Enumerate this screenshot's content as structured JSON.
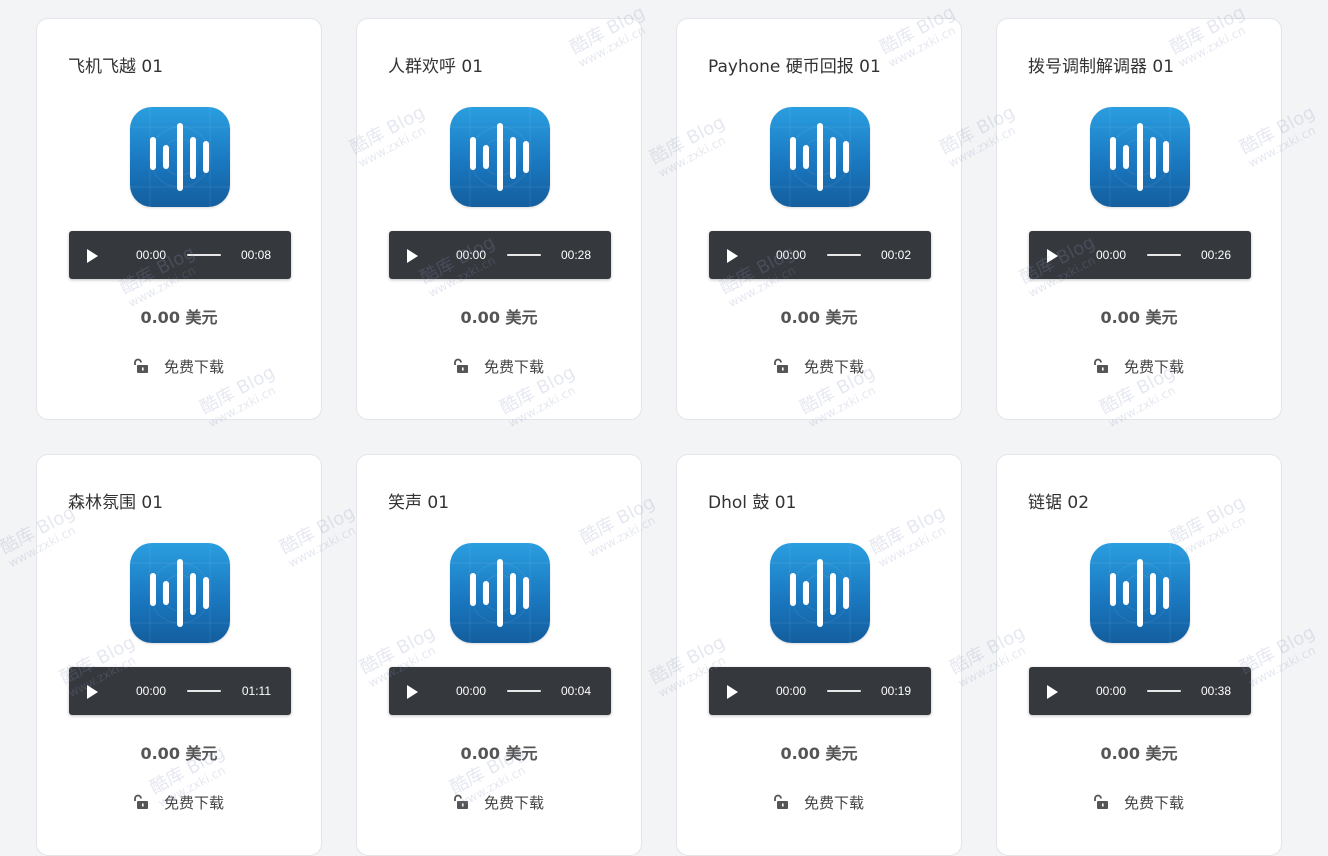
{
  "colors": {
    "icon_top": "#2a9ee0",
    "icon_bottom": "#135e9e",
    "player_bg": "#35383d"
  },
  "cards": [
    {
      "title": "飞机飞越 01",
      "current_time": "00:00",
      "duration": "00:08",
      "price": "0.00 美元",
      "download_label": "免费下载"
    },
    {
      "title": "人群欢呼 01",
      "current_time": "00:00",
      "duration": "00:28",
      "price": "0.00 美元",
      "download_label": "免费下载"
    },
    {
      "title": "Payhone 硬币回报 01",
      "current_time": "00:00",
      "duration": "00:02",
      "price": "0.00 美元",
      "download_label": "免费下载"
    },
    {
      "title": "拨号调制解调器 01",
      "current_time": "00:00",
      "duration": "00:26",
      "price": "0.00 美元",
      "download_label": "免费下载"
    },
    {
      "title": "森林氛围 01",
      "current_time": "00:00",
      "duration": "01:11",
      "price": "0.00 美元",
      "download_label": "免费下载"
    },
    {
      "title": "笑声 01",
      "current_time": "00:00",
      "duration": "00:04",
      "price": "0.00 美元",
      "download_label": "免费下载"
    },
    {
      "title": "Dhol 鼓 01",
      "current_time": "00:00",
      "duration": "00:19",
      "price": "0.00 美元",
      "download_label": "免费下载"
    },
    {
      "title": "链锯 02",
      "current_time": "00:00",
      "duration": "00:38",
      "price": "0.00 美元",
      "download_label": "免费下载"
    }
  ],
  "watermark": {
    "line1": "酷库 Blog",
    "line2": "www.zxki.cn"
  }
}
